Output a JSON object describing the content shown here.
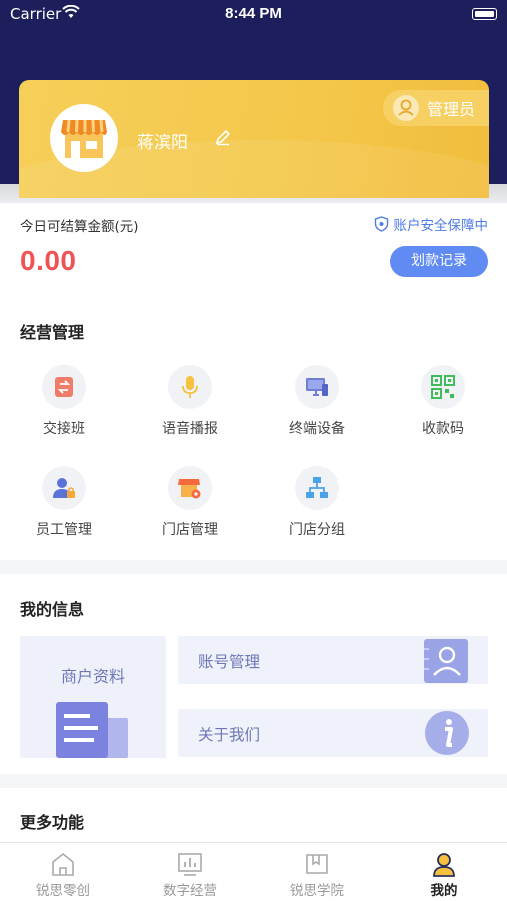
{
  "status_bar": {
    "carrier": "Carrier",
    "time": "8:44 PM"
  },
  "profile": {
    "name": "蒋滨阳",
    "role_badge": "管理员"
  },
  "balance": {
    "label": "今日可结算金额(元)",
    "security_text": "账户安全保障中",
    "amount": "0.00",
    "records_button": "划款记录"
  },
  "business": {
    "title": "经营管理",
    "items": [
      {
        "label": "交接班",
        "icon": "shift-handover-icon"
      },
      {
        "label": "语音播报",
        "icon": "microphone-icon"
      },
      {
        "label": "终端设备",
        "icon": "terminal-device-icon"
      },
      {
        "label": "收款码",
        "icon": "qr-code-icon"
      },
      {
        "label": "员工管理",
        "icon": "employee-icon"
      },
      {
        "label": "门店管理",
        "icon": "store-settings-icon"
      },
      {
        "label": "门店分组",
        "icon": "store-group-icon"
      }
    ]
  },
  "my_info": {
    "title": "我的信息",
    "merchant_profile": "商户资料",
    "account_management": "账号管理",
    "about_us": "关于我们"
  },
  "more": {
    "title": "更多功能"
  },
  "tabbar": {
    "tabs": [
      {
        "label": "锐思零创",
        "icon": "home-icon"
      },
      {
        "label": "数字经营",
        "icon": "chart-icon"
      },
      {
        "label": "锐思学院",
        "icon": "book-icon"
      },
      {
        "label": "我的",
        "icon": "user-icon"
      }
    ],
    "active": "我的"
  },
  "colors": {
    "header_bg": "#1c1f5c",
    "card_gold": "#f4c74a",
    "accent_blue": "#5f8bf3",
    "amount_red": "#ef5353"
  }
}
